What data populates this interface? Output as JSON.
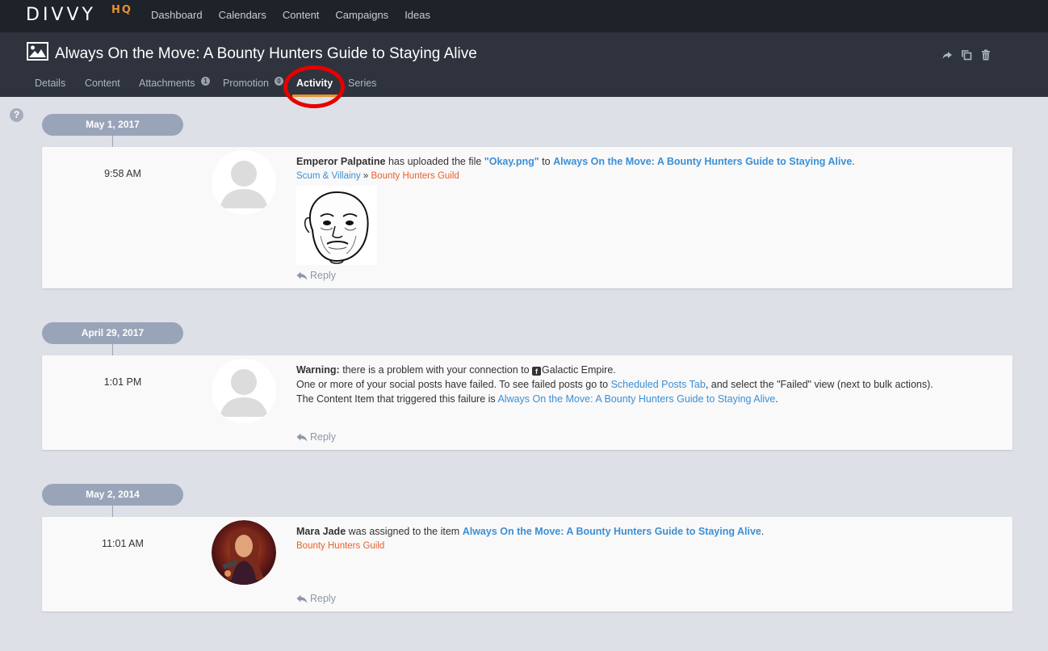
{
  "brand": {
    "logo_text": "DIVVY",
    "logo_suffix": "HQ"
  },
  "nav": [
    "Dashboard",
    "Calendars",
    "Content",
    "Campaigns",
    "Ideas"
  ],
  "page": {
    "title": "Always On the Move: A Bounty Hunters Guide to Staying Alive"
  },
  "tabs": [
    {
      "label": "Details"
    },
    {
      "label": "Content"
    },
    {
      "label": "Attachments",
      "badge": "1"
    },
    {
      "label": "Promotion",
      "badge": "0"
    },
    {
      "label": "Activity",
      "active": true
    },
    {
      "label": "Series"
    }
  ],
  "header_actions": [
    "share-icon",
    "copy-icon",
    "trash-icon"
  ],
  "help": {
    "symbol": "?"
  },
  "activity": [
    {
      "date": "May 1, 2017",
      "time": "9:58 AM",
      "actor": "Emperor Palpatine",
      "action": "has uploaded the file",
      "file": "\"Okay.png\"",
      "to_word": "to",
      "item": "Always On the Move: A Bounty Hunters Guide to Staying Alive",
      "end": ".",
      "path_a": "Scum & Villainy",
      "path_sep": "»",
      "path_b": "Bounty Hunters Guild",
      "reply": "Reply"
    },
    {
      "date": "April 29, 2017",
      "time": "1:01 PM",
      "warning_label": "Warning:",
      "warning_text": "there is a problem with your connection to",
      "network": "Galactic Empire.",
      "line2_a": "One or more of your social posts have failed. To see failed posts go to",
      "line2_link": "Scheduled Posts Tab",
      "line2_b": ", and select the \"Failed\" view (next to bulk actions).",
      "line3_a": "The Content Item that triggered this failure is",
      "line3_link": "Always On the Move: A Bounty Hunters Guide to Staying Alive",
      "line3_end": ".",
      "reply": "Reply"
    },
    {
      "date": "May 2, 2014",
      "time": "11:01 AM",
      "actor": "Mara Jade",
      "action": "was assigned to the item",
      "item": "Always On the Move: A Bounty Hunters Guide to Staying Alive",
      "end": ".",
      "group": "Bounty Hunters Guild",
      "reply": "Reply"
    }
  ],
  "colors": {
    "accent": "#e8912f",
    "link": "#3b8fd6",
    "group": "#e8612c",
    "highlight": "#e60000"
  }
}
